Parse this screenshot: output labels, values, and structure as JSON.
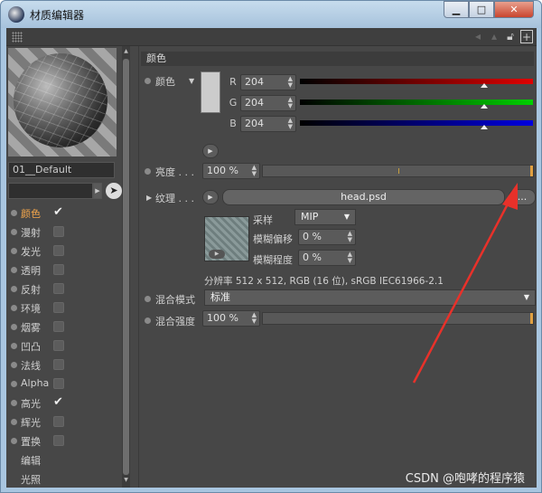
{
  "window": {
    "title": "材质编辑器"
  },
  "material": {
    "name": "01__Default"
  },
  "channels": [
    {
      "label": "颜色",
      "checked": true,
      "active": true,
      "has_checkbox": true
    },
    {
      "label": "漫射",
      "checked": false,
      "has_checkbox": true
    },
    {
      "label": "发光",
      "checked": false,
      "has_checkbox": true
    },
    {
      "label": "透明",
      "checked": false,
      "has_checkbox": true
    },
    {
      "label": "反射",
      "checked": false,
      "has_checkbox": true
    },
    {
      "label": "环境",
      "checked": false,
      "has_checkbox": true
    },
    {
      "label": "烟雾",
      "checked": false,
      "has_checkbox": true
    },
    {
      "label": "凹凸",
      "checked": false,
      "has_checkbox": true
    },
    {
      "label": "法线",
      "checked": false,
      "has_checkbox": true
    },
    {
      "label": "Alpha",
      "checked": false,
      "has_checkbox": true
    },
    {
      "label": "高光",
      "checked": true,
      "has_checkbox": true
    },
    {
      "label": "辉光",
      "checked": false,
      "has_checkbox": true
    },
    {
      "label": "置换",
      "checked": false,
      "has_checkbox": true
    },
    {
      "label": "编辑",
      "has_checkbox": false
    },
    {
      "label": "光照",
      "has_checkbox": false
    }
  ],
  "color_section": {
    "header": "颜色",
    "color_label": "颜色",
    "r_label": "R",
    "r_value": "204",
    "g_label": "G",
    "g_value": "204",
    "b_label": "B",
    "b_value": "204",
    "swatch_color": "#cccccc",
    "brightness_label": "亮度 . . .",
    "brightness_value": "100 %",
    "texture_label": "纹理 . . .",
    "texture_file": "head.psd",
    "browse_label": "...",
    "sampling_label": "采样",
    "sampling_value": "MIP",
    "blur_offset_label": "模糊偏移",
    "blur_offset_value": "0 %",
    "blur_scale_label": "模糊程度",
    "blur_scale_value": "0 %",
    "resolution_info": "分辨率 512 x 512, RGB (16 位), sRGB IEC61966-2.1",
    "blend_mode_label": "混合模式",
    "blend_mode_value": "标准",
    "blend_strength_label": "混合强度",
    "blend_strength_value": "100 %"
  },
  "watermark": "CSDN @咆哮的程序猿",
  "colors": {
    "accent": "#f3a64b",
    "annotation_arrow": "#e8312a"
  }
}
